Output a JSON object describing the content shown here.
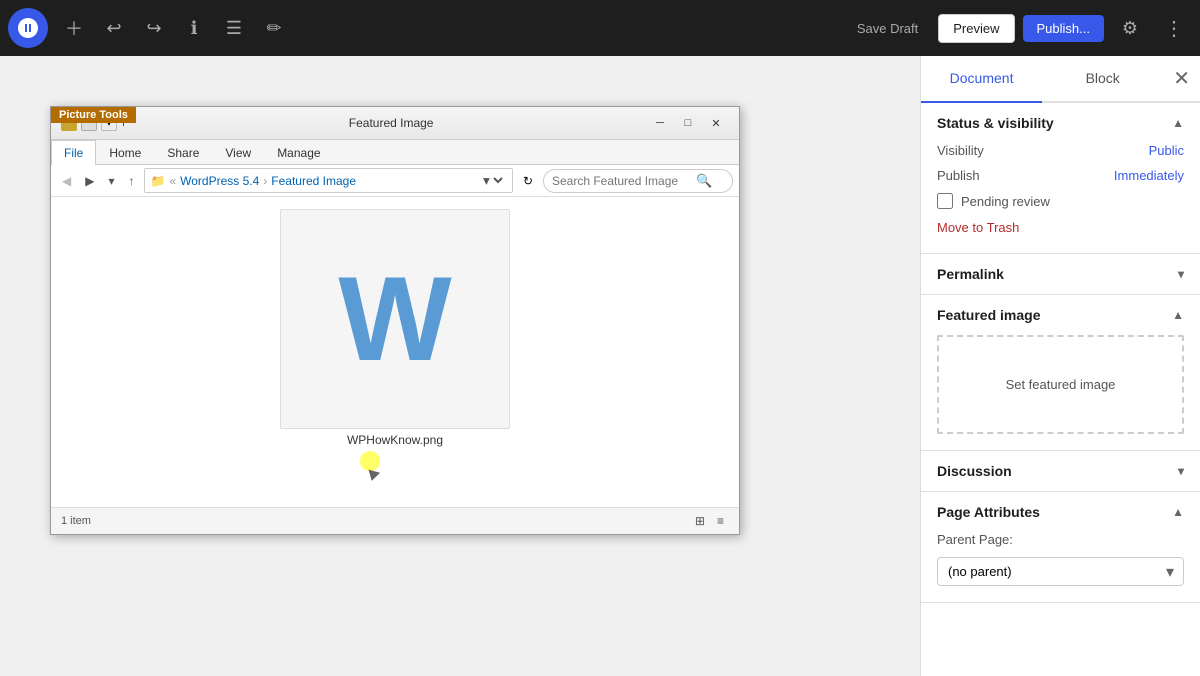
{
  "toolbar": {
    "save_draft_label": "Save Draft",
    "preview_label": "Preview",
    "publish_label": "Publish...",
    "document_tab": "Document",
    "block_tab": "Block"
  },
  "explorer": {
    "title": "Featured Image",
    "picture_tools_label": "Picture Tools",
    "tabs": [
      "File",
      "Home",
      "Share",
      "View",
      "Manage"
    ],
    "active_tab": "File",
    "path": {
      "parts": [
        "WordPress 5.4",
        "Featured Image"
      ]
    },
    "search_placeholder": "Search Featured Image",
    "file_name": "WPHowKnow.png",
    "status": "1 item"
  },
  "sidebar": {
    "document_tab": "Document",
    "block_tab": "Block",
    "status_visibility": {
      "section_title": "Status & visibility",
      "visibility_label": "Visibility",
      "visibility_value": "Public",
      "publish_label": "Publish",
      "publish_value": "Immediately",
      "pending_review_label": "Pending review",
      "move_to_trash": "Move to Trash"
    },
    "permalink": {
      "section_title": "Permalink"
    },
    "featured_image": {
      "section_title": "Featured image",
      "set_label": "Set featured image"
    },
    "discussion": {
      "section_title": "Discussion"
    },
    "page_attributes": {
      "section_title": "Page Attributes",
      "parent_label": "Parent Page:",
      "parent_value": "(no parent)"
    }
  }
}
